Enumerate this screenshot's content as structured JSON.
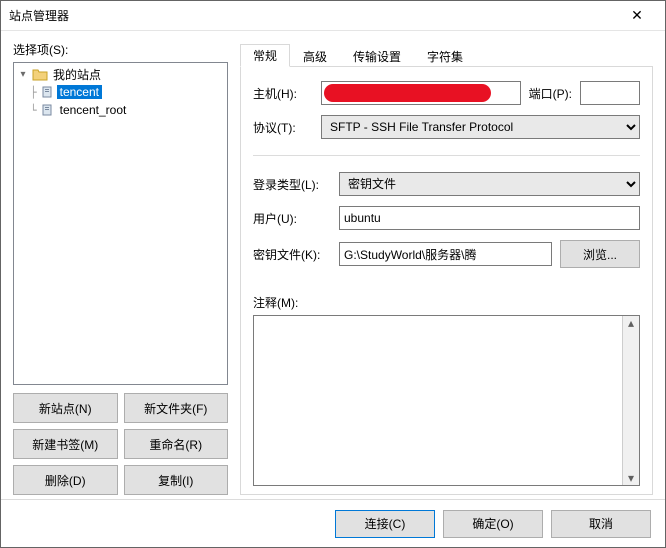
{
  "window": {
    "title": "站点管理器"
  },
  "left": {
    "label": "选择项(S):",
    "tree": {
      "root": "我的站点",
      "items": [
        {
          "label": "tencent",
          "selected": true
        },
        {
          "label": "tencent_root",
          "selected": false
        }
      ]
    },
    "buttons": {
      "new_site": "新站点(N)",
      "new_folder": "新文件夹(F)",
      "new_bookmark": "新建书签(M)",
      "rename": "重命名(R)",
      "delete": "删除(D)",
      "copy": "复制(I)"
    }
  },
  "tabs": [
    "常规",
    "高级",
    "传输设置",
    "字符集"
  ],
  "active_tab": 0,
  "general": {
    "host_label": "主机(H):",
    "host_value": "",
    "port_label": "端口(P):",
    "port_value": "",
    "protocol_label": "协议(T):",
    "protocol_value": "SFTP - SSH File Transfer Protocol",
    "logon_label": "登录类型(L):",
    "logon_value": "密钥文件",
    "user_label": "用户(U):",
    "user_value": "ubuntu",
    "keyfile_label": "密钥文件(K):",
    "keyfile_value": "G:\\StudyWorld\\服务器\\腾",
    "browse": "浏览...",
    "notes_label": "注释(M):",
    "notes_value": ""
  },
  "footer": {
    "connect": "连接(C)",
    "ok": "确定(O)",
    "cancel": "取消"
  }
}
